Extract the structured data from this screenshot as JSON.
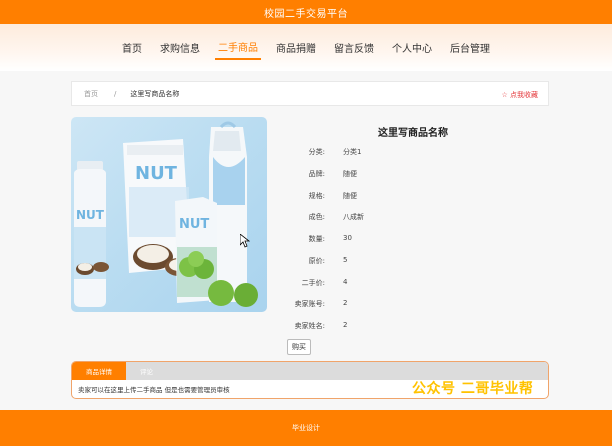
{
  "header": {
    "site_title": "校园二手交易平台"
  },
  "nav": {
    "items": [
      {
        "label": "首页"
      },
      {
        "label": "求购信息"
      },
      {
        "label": "二手商品"
      },
      {
        "label": "商品捐赠"
      },
      {
        "label": "留言反馈"
      },
      {
        "label": "个人中心"
      },
      {
        "label": "后台管理"
      }
    ],
    "active_index": 2
  },
  "breadcrumb": {
    "home": "首页",
    "separator": "/",
    "current": "这里写商品名称"
  },
  "favorite": {
    "label": "☆ 点我收藏"
  },
  "product": {
    "title": "这里写商品名称",
    "image_icon": "product-photo",
    "details": [
      {
        "label": "分类:",
        "value": "分类1"
      },
      {
        "label": "品牌:",
        "value": "随便"
      },
      {
        "label": "规格:",
        "value": "随便"
      },
      {
        "label": "成色:",
        "value": "八成新"
      },
      {
        "label": "数量:",
        "value": "30"
      },
      {
        "label": "原价:",
        "value": "5"
      },
      {
        "label": "二手价:",
        "value": "4"
      },
      {
        "label": "卖家账号:",
        "value": "2"
      },
      {
        "label": "卖家姓名:",
        "value": "2"
      }
    ],
    "buy_label": "购买"
  },
  "tabs": {
    "items": [
      {
        "label": "商品详情"
      },
      {
        "label": "评论"
      }
    ],
    "content": "卖家可以在这里上传二手商品 但是也需要管理员审核"
  },
  "watermark": "公众号 二哥毕业帮",
  "footer": {
    "text": "毕业设计"
  },
  "colors": {
    "accent": "#ff7f00",
    "favorite": "#e4393c",
    "watermark": "#ffc200"
  }
}
